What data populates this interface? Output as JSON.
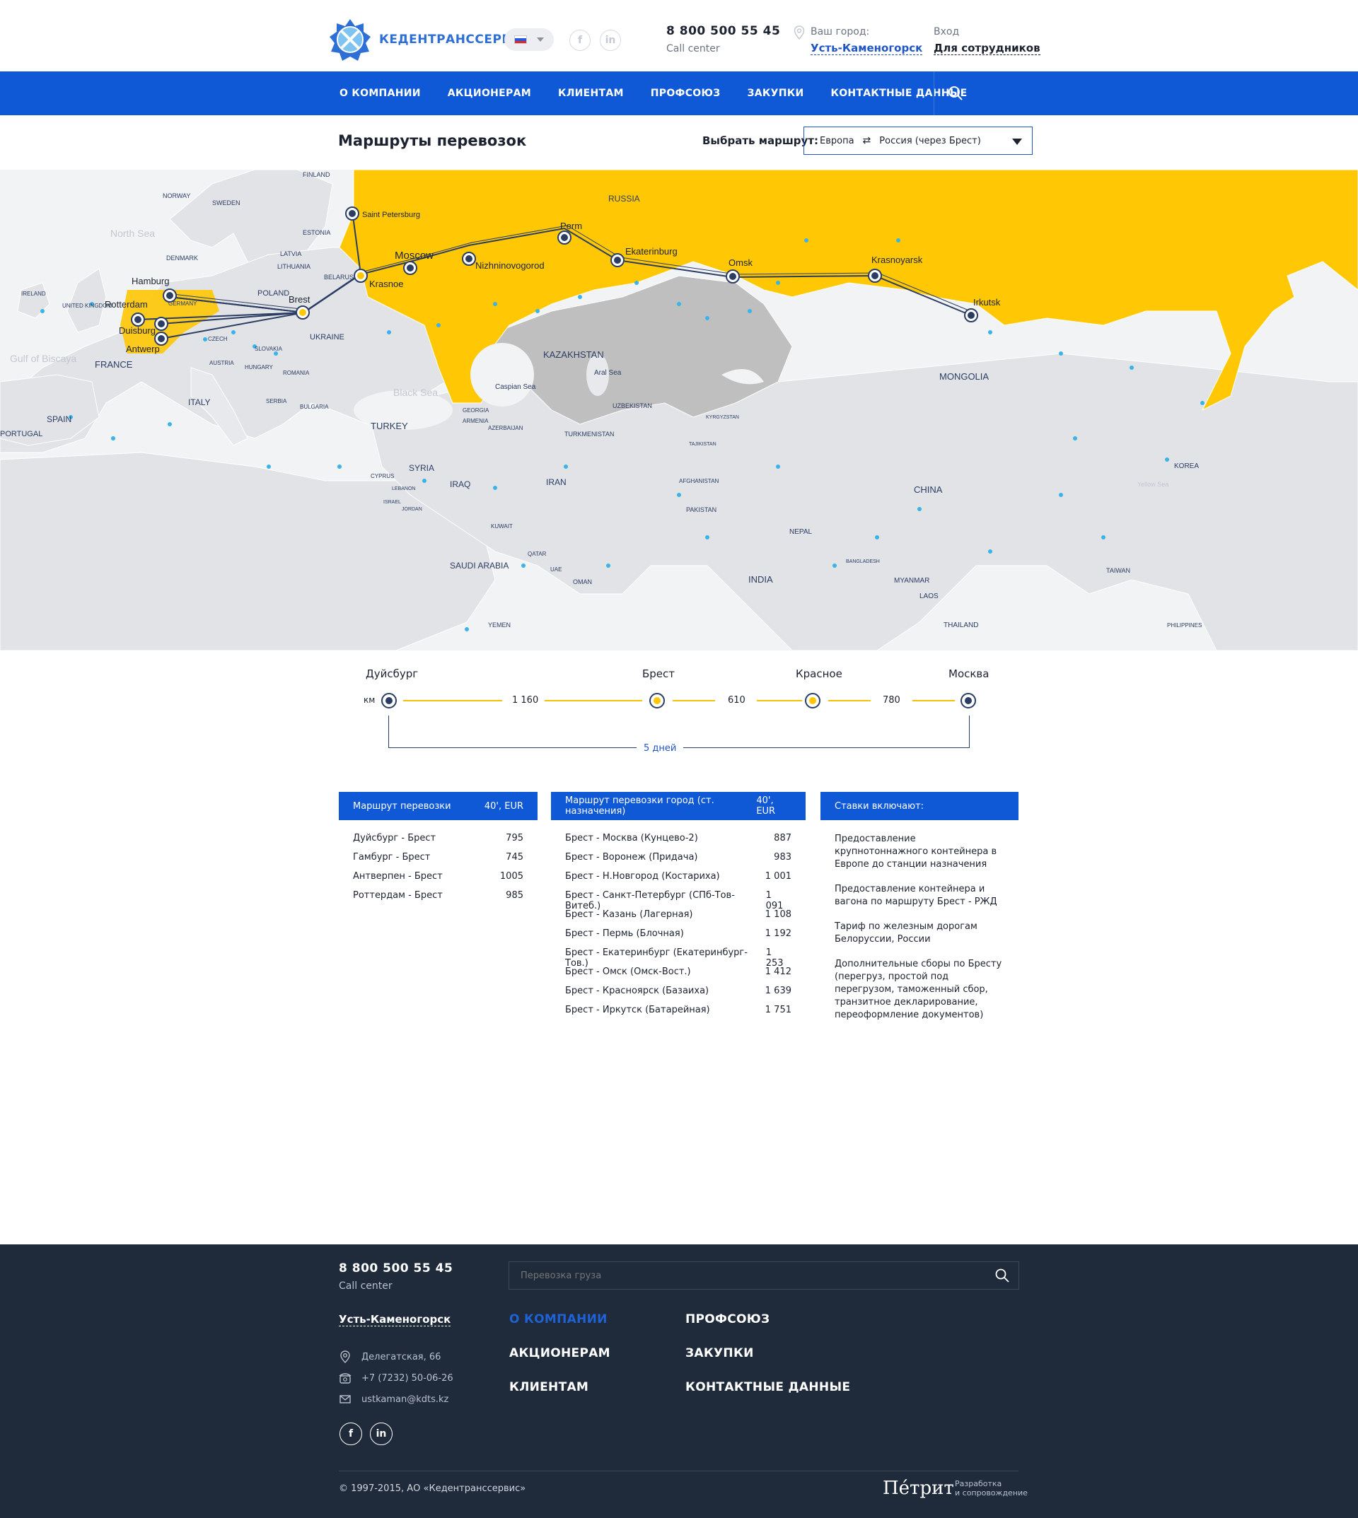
{
  "header": {
    "brand": "КЕДЕНТРАНССЕРВИС",
    "phone": "8 800 500 55 45",
    "call_center": "Call center",
    "city_label": "Ваш город:",
    "city_value": "Усть-Каменогорск",
    "login_label": "Вход",
    "login_value": "Для сотрудников",
    "social": [
      "f",
      "in"
    ]
  },
  "nav": {
    "items": [
      "О КОМПАНИИ",
      "АКЦИОНЕРАМ",
      "КЛИЕНТАМ",
      "ПРОФСОЮЗ",
      "ЗАКУПКИ",
      "КОНТАКТНЫЕ ДАННЫЕ"
    ]
  },
  "page": {
    "title": "Маршруты перевозок",
    "route_label": "Выбрать маршрут:",
    "route_from": "Европа",
    "route_to": "Россия (через Брест)"
  },
  "map": {
    "countries": [
      "FINLAND",
      "NORWAY",
      "SWEDEN",
      "ESTONIA",
      "LATVIA",
      "LITHUANIA",
      "DENMARK",
      "BELARUS",
      "POLAND",
      "UKRAINE",
      "GERMANY",
      "CZECH",
      "SLOVAKIA",
      "AUSTRIA",
      "HUNGARY",
      "ROMANIA",
      "SERBIA",
      "BULGARIA",
      "IRELAND",
      "UNITED KINGDOM",
      "FRANCE",
      "ITALY",
      "SPAIN",
      "PORTUGAL",
      "TURKEY",
      "GEORGIA",
      "ARMENIA",
      "AZERBAIJAN",
      "SYRIA",
      "IRAQ",
      "IRAN",
      "SAUDI ARABIA",
      "KUWAIT",
      "QATAR",
      "UAE",
      "OMAN",
      "YEMEN",
      "CYPRUS",
      "LEBANON",
      "ISRAEL",
      "JORDAN",
      "TURKMENISTAN",
      "UZBEKISTAN",
      "KYRGYZSTAN",
      "TAJIKISTAN",
      "AFGHANISTAN",
      "PAKISTAN",
      "INDIA",
      "NEPAL",
      "BANGLADESH",
      "MYANMAR",
      "THAILAND",
      "LAOS",
      "CHINA",
      "MONGOLIA",
      "KOREA",
      "TAIWAN",
      "PHILIPPINES",
      "RUSSIA",
      "KAZAKHSTAN"
    ],
    "seas": [
      "North Sea",
      "Gulf of Biscaya",
      "Black Sea",
      "Caspian Sea",
      "Aral Sea",
      "Yellow Sea"
    ],
    "route_stops": [
      "Hamburg",
      "Rotterdam",
      "Duisburg",
      "Antwerp",
      "Brest",
      "Krasnoe",
      "Saint Petersburg",
      "Moscow",
      "Nizhninovogorod",
      "Perm",
      "Ekaterinburg",
      "Omsk",
      "Krasnoyarsk",
      "Irkutsk"
    ],
    "colors": {
      "russia": "#ffc704",
      "kazakhstan": "#bfbfbf",
      "land": "#e1e3e7",
      "water": "#f2f3f5",
      "route": "#2b3d63",
      "city": "#3ab4e8"
    }
  },
  "timeline": {
    "unit": "км",
    "stations": [
      "Дуйсбург",
      "Брест",
      "Красное",
      "Москва"
    ],
    "distances": [
      "1 160",
      "610",
      "780"
    ],
    "duration": "5 дней"
  },
  "table1": {
    "head_left": "Маршрут перевозки",
    "head_right": "40', EUR",
    "rows": [
      {
        "route": "Дуйсбург - Брест",
        "price": "795"
      },
      {
        "route": "Гамбург - Брест",
        "price": "745"
      },
      {
        "route": "Антверпен - Брест",
        "price": "1005"
      },
      {
        "route": "Роттердам - Брест",
        "price": "985"
      }
    ]
  },
  "table2": {
    "head_left": "Маршрут перевозки город (ст. назначения)",
    "head_right": "40', EUR",
    "rows": [
      {
        "route": "Брест - Москва (Кунцево-2)",
        "price": "887"
      },
      {
        "route": "Брест - Воронеж (Придача)",
        "price": "983"
      },
      {
        "route": "Брест - Н.Новгород (Костариха)",
        "price": "1 001"
      },
      {
        "route": "Брест - Санкт-Петербург (СПб-Тов-Витеб.)",
        "price": "1 091"
      },
      {
        "route": "Брест - Казань (Лагерная)",
        "price": "1 108"
      },
      {
        "route": "Брест - Пермь (Блочная)",
        "price": "1 192"
      },
      {
        "route": "Брест - Екатеринбург (Екатеринбург-Тов.)",
        "price": "1 253"
      },
      {
        "route": "Брест - Омск (Омск-Вост.)",
        "price": "1 412"
      },
      {
        "route": "Брест - Красноярск (Базаиха)",
        "price": "1 639"
      },
      {
        "route": "Брест - Иркутск (Батарейная)",
        "price": "1 751"
      }
    ]
  },
  "table3": {
    "head": "Ставки включают:",
    "items": [
      "Предоставление крупнотоннажного контейнера в Европе до станции назначения",
      "Предоставление контейнера и вагона по маршруту Брест - РЖД",
      "Тариф по железным дорогам Белоруссии, России",
      "Дополнительные сборы по Бресту (перегруз, простой под перегрузом, таможенный сбор, транзитное декларирование, переоформление документов)"
    ]
  },
  "footer": {
    "phone": "8 800 500 55 45",
    "call_center": "Call center",
    "city": "Усть-Каменогорск",
    "address": "Делегатская, 66",
    "tel": "+7 (7232) 50-06-26",
    "email": "ustkaman@kdts.kz",
    "search_placeholder": "Перевозка груза",
    "nav": [
      "О КОМПАНИИ",
      "АКЦИОНЕРАМ",
      "КЛИЕНТАМ",
      "ПРОФСОЮЗ",
      "ЗАКУПКИ",
      "КОНТАКТНЫЕ ДАННЫЕ"
    ],
    "social": [
      "f",
      "in"
    ],
    "copyright": "© 1997-2015, АО «Кедентранссервис»",
    "dev_brand": "Пéтрит",
    "dev_line1": "Разработка",
    "dev_line2": "и сопровождение"
  }
}
